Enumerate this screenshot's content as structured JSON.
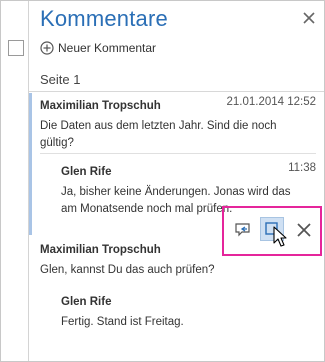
{
  "pane": {
    "title": "Kommentare",
    "close_icon": "close-icon"
  },
  "new_comment": {
    "label": "Neuer Kommentar",
    "icon": "plus-circle-icon"
  },
  "page_section": {
    "label": "Seite 1"
  },
  "threads": [
    {
      "author": "Maximilian Tropschuh",
      "timestamp": "21.01.2014 12:52",
      "text_line1": "Die Daten aus dem letzten Jahr. Sind die noch",
      "text_line2": "gültig?",
      "reply": {
        "author": "Glen Rife",
        "timestamp": "11:38",
        "text_line1": "Ja, bisher keine Änderungen. Jonas wird das",
        "text_line2": "am Monatsende noch mal prüfen."
      },
      "actions": {
        "reply_icon": "reply-comment-icon",
        "resolve_icon": "resolve-icon",
        "delete_icon": "delete-icon"
      }
    },
    {
      "author": "Maximilian Tropschuh",
      "text_line1": "Glen, kannst Du das auch prüfen?",
      "reply": {
        "author": "Glen Rife",
        "text_line1": "Fertig. Stand ist Freitag."
      }
    }
  ],
  "colors": {
    "title_blue": "#2b6fb6",
    "accent_bar": "#a9c4e6",
    "highlight_magenta": "#e5259b",
    "resolve_fill": "#cfe0f3"
  }
}
